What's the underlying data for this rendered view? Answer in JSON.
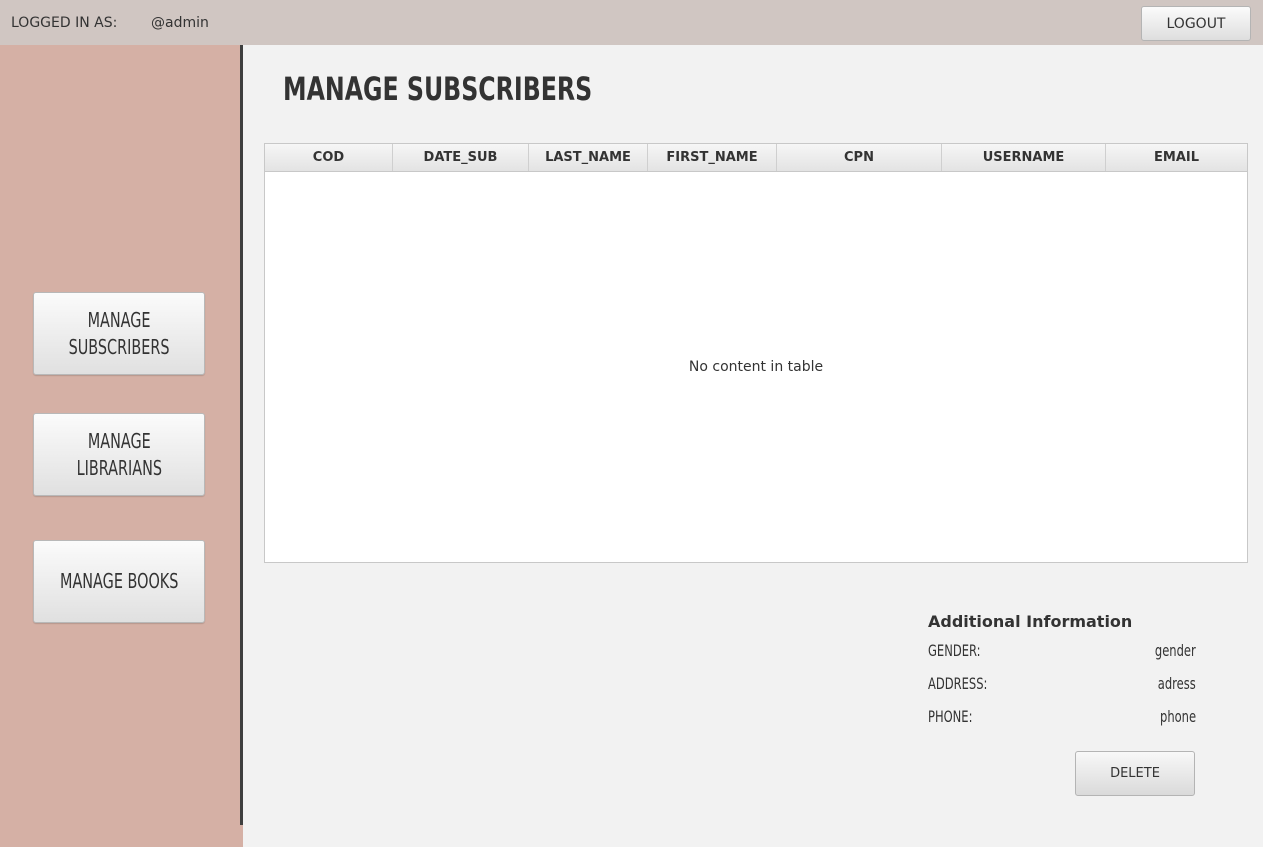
{
  "header": {
    "logged_in_label": "LOGGED IN AS:",
    "username": "@admin",
    "logout_label": "LOGOUT"
  },
  "sidebar": {
    "items": [
      {
        "label": "MANAGE\nSUBSCRIBERS"
      },
      {
        "label": "MANAGE\nLIBRARIANS"
      },
      {
        "label": "MANAGE BOOKS"
      }
    ]
  },
  "main": {
    "title": "MANAGE SUBSCRIBERS",
    "table": {
      "columns": [
        "COD",
        "DATE_SUB",
        "LAST_NAME",
        "FIRST_NAME",
        "CPN",
        "USERNAME",
        "EMAIL"
      ],
      "rows": [],
      "empty_message": "No content in table"
    },
    "additional_info": {
      "title": "Additional Information",
      "fields": [
        {
          "label": "GENDER:",
          "value": "gender"
        },
        {
          "label": "ADDRESS:",
          "value": "adress"
        },
        {
          "label": "PHONE:",
          "value": "phone"
        }
      ]
    },
    "delete_label": "DELETE"
  },
  "colors": {
    "topbar": "#d0c6c2",
    "sidebar": "#d5b0a5",
    "content_bg": "#f2f2f2",
    "divider": "#3f3f3f"
  }
}
